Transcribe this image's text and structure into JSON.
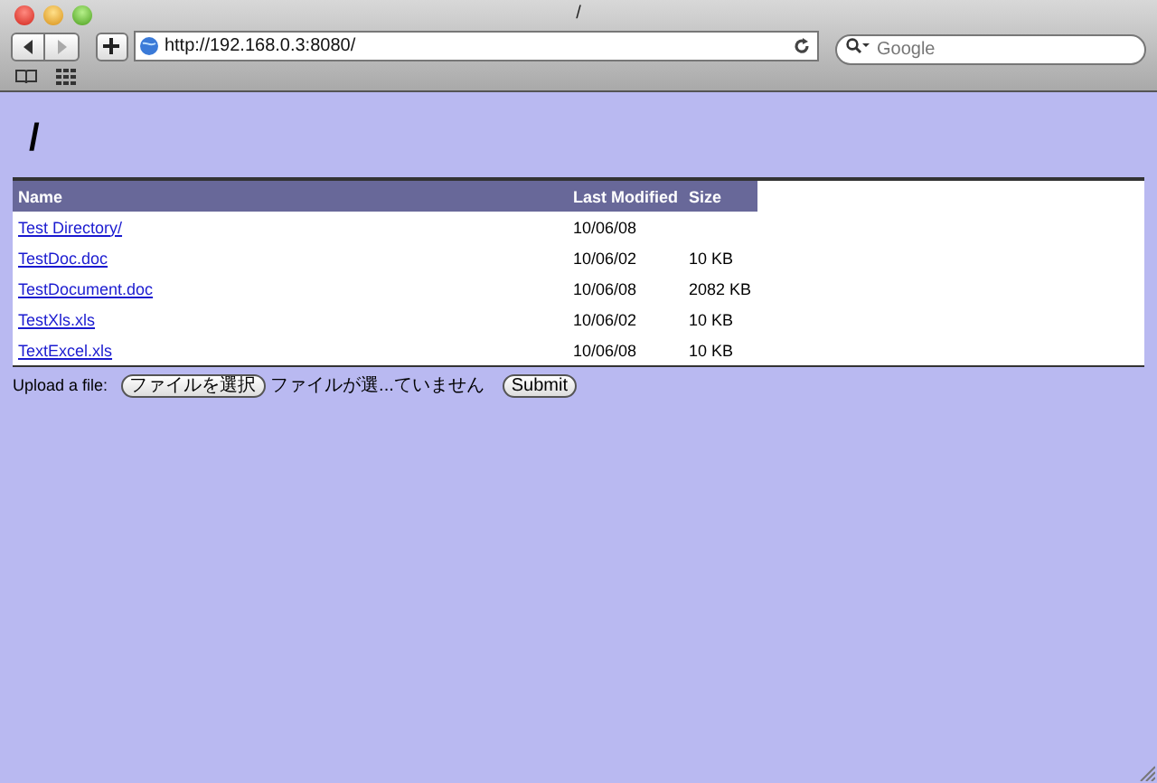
{
  "window": {
    "title": "/"
  },
  "toolbar": {
    "url": "http://192.168.0.3:8080/",
    "search_placeholder": "Google"
  },
  "page": {
    "heading": "/",
    "table": {
      "columns": [
        "Name",
        "Last Modified",
        "Size"
      ],
      "rows": [
        {
          "name": "Test Directory/",
          "modified": "10/06/08"
        },
        {
          "name": "TestDoc.doc",
          "modified": "10/06/02",
          "size": "10 KB"
        },
        {
          "name": "TestDocument.doc",
          "modified": "10/06/08",
          "size": "2082 KB"
        },
        {
          "name": "TestXls.xls",
          "modified": "10/06/02",
          "size": "10 KB"
        },
        {
          "name": "TextExcel.xls",
          "modified": "10/06/08",
          "size": "10 KB"
        }
      ]
    },
    "upload": {
      "label": "Upload a file:",
      "choose_button": "ファイルを選択",
      "file_status": "ファイルが選...ていません",
      "submit_button": "Submit"
    }
  }
}
